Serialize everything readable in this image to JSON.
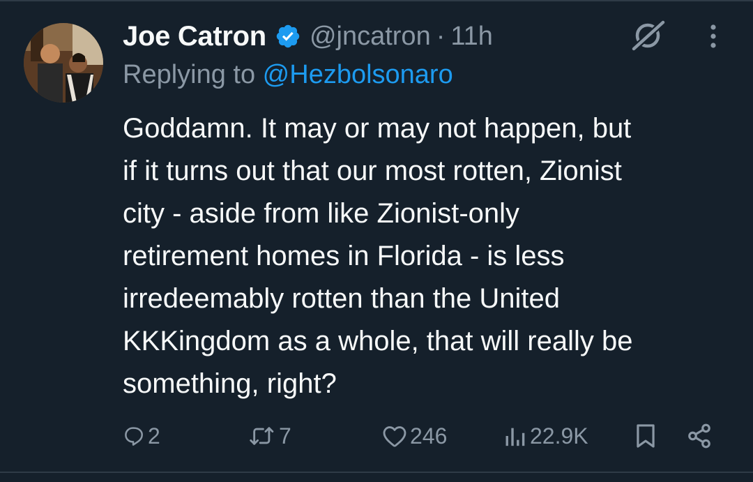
{
  "tweet": {
    "author": {
      "display_name": "Joe Catron",
      "handle": "@jncatron",
      "verified": true
    },
    "separator": "·",
    "time": "11h",
    "replying_prefix": "Replying to ",
    "replying_handle": "@Hezbolsonaro",
    "text": "Goddamn. It may or may not happen, but\nif it turns out that our most rotten, Zionist\ncity - aside from like Zionist-only\nretirement homes in Florida - is less\nirredeemably rotten than the United\nKKKingdom as a whole, that will really be\nsomething, right?"
  },
  "actions": {
    "replies": "2",
    "reposts": "7",
    "likes": "246",
    "views": "22.9K"
  },
  "icons": {
    "verified": "verified-badge-icon",
    "grok": "grok-icon",
    "more": "more-vertical-icon",
    "reply": "reply-icon",
    "repost": "repost-icon",
    "like": "heart-icon",
    "views": "views-icon",
    "bookmark": "bookmark-icon",
    "share": "share-icon"
  },
  "colors": {
    "background": "#15202b",
    "text_primary": "#f7f9f9",
    "text_secondary": "#8b98a5",
    "accent": "#1d9bf0"
  }
}
